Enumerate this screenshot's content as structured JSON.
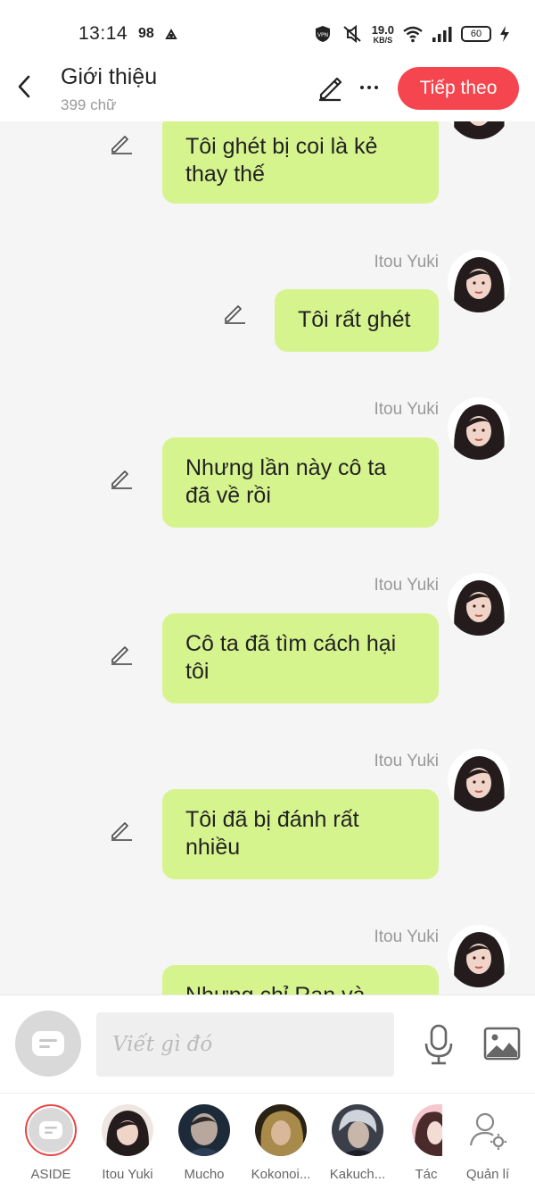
{
  "status": {
    "time": "13:14",
    "notif_count": "98",
    "net_speed_value": "19.0",
    "net_speed_unit": "KB/S",
    "battery": "60"
  },
  "header": {
    "title": "Giới thiệu",
    "subtitle": "399 chữ",
    "next_label": "Tiếp theo"
  },
  "messages": [
    {
      "sender": "",
      "text_lines": [
        "Tôi ghét bị coi là kẻ",
        "thay thế"
      ]
    },
    {
      "sender": "Itou Yuki",
      "text_lines": [
        "Tôi rất ghét"
      ]
    },
    {
      "sender": "Itou Yuki",
      "text_lines": [
        "Nhưng lần này cô ta",
        "đã về rồi"
      ]
    },
    {
      "sender": "Itou Yuki",
      "text_lines": [
        "Cô ta đã tìm cách hại",
        "tôi"
      ]
    },
    {
      "sender": "Itou Yuki",
      "text_lines": [
        "Tôi đã bị đánh rất",
        "nhiều"
      ]
    },
    {
      "sender": "Itou Yuki",
      "text_lines": [
        "Nhưng chỉ Ran và"
      ]
    }
  ],
  "input": {
    "placeholder": "Viết gì đó"
  },
  "characters": [
    {
      "label": "ASIDE"
    },
    {
      "label": "Itou Yuki"
    },
    {
      "label": "Mucho"
    },
    {
      "label": "Kokonoi..."
    },
    {
      "label": "Kakuch..."
    },
    {
      "label": "Tác"
    },
    {
      "label": "Quản lí"
    }
  ],
  "colors": {
    "accent": "#f5454f",
    "bubble": "#d6f48e",
    "background": "#f5f5f5"
  },
  "icons": {
    "back": "chevron-left-icon",
    "edit": "pencil-icon",
    "more": "more-dots-icon",
    "mic": "microphone-icon",
    "image": "image-icon",
    "manage": "user-settings-icon"
  }
}
